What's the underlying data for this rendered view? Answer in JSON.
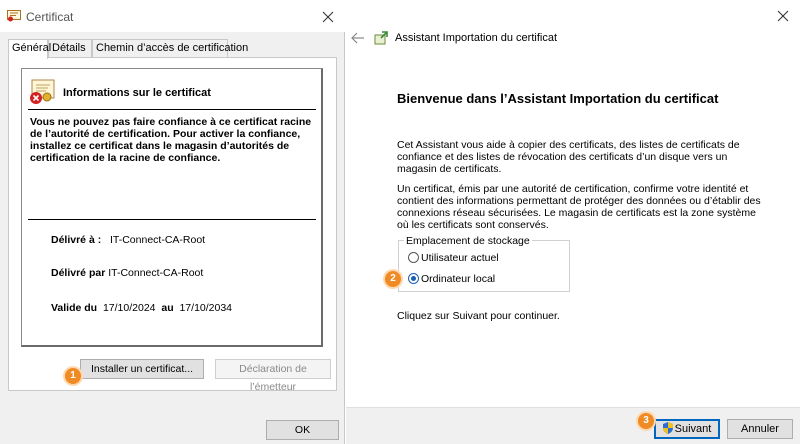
{
  "certificate_window": {
    "title": "Certificat",
    "tabs": [
      {
        "label": "Général",
        "active": true
      },
      {
        "label": "Détails",
        "active": false
      },
      {
        "label": "Chemin d’accès de certification",
        "active": false
      }
    ],
    "info_heading": "Informations sur le certificat",
    "warning": "Vous ne pouvez pas faire confiance à ce certificat racine de l’autorité de certification. Pour activer la confiance, installez ce certificat dans le magasin d’autorités de certification de la racine de confiance.",
    "issued_to_label": "Délivré à :",
    "issued_to_value": "IT-Connect-CA-Root",
    "issued_by_label": "Délivré par",
    "issued_by_value": "IT-Connect-CA-Root",
    "valid_from_label": "Valide du",
    "valid_from_value": "17/10/2024",
    "valid_to_label": "au",
    "valid_to_value": "17/10/2034",
    "install_button": "Installer un certificat...",
    "issuer_statement_button": "Déclaration de l’émetteur",
    "ok_button": "OK"
  },
  "wizard_window": {
    "title": "Assistant Importation du certificat",
    "heading": "Bienvenue dans l’Assistant Importation du certificat",
    "paragraph1": "Cet Assistant vous aide à copier des certificats, des listes de certificats de confiance et des listes de révocation des certificats d’un disque vers un magasin de certificats.",
    "paragraph2": "Un certificat, émis par une autorité de certification, confirme votre identité et contient des informations permettant de protéger des données ou d’établir des connexions réseau sécurisées. Le magasin de certificats est la zone système où les certificats sont conservés.",
    "storage_legend": "Emplacement de stockage",
    "storage_options": [
      {
        "label": "Utilisateur actuel",
        "checked": false
      },
      {
        "label": "Ordinateur local",
        "checked": true
      }
    ],
    "continue_text": "Cliquez sur Suivant pour continuer.",
    "next_button": "Suivant",
    "cancel_button": "Annuler"
  },
  "step_badges": [
    "1",
    "2",
    "3"
  ],
  "colors": {
    "accent": "#0067c0",
    "badge": "#f08a24",
    "radio_checked": "#1a5fb4"
  },
  "icons": {
    "title_icon": "certificate-icon",
    "close": "close-icon",
    "back": "back-arrow-icon",
    "wizard_icon": "certificate-wizard-icon",
    "next_shield": "uac-shield-icon"
  }
}
